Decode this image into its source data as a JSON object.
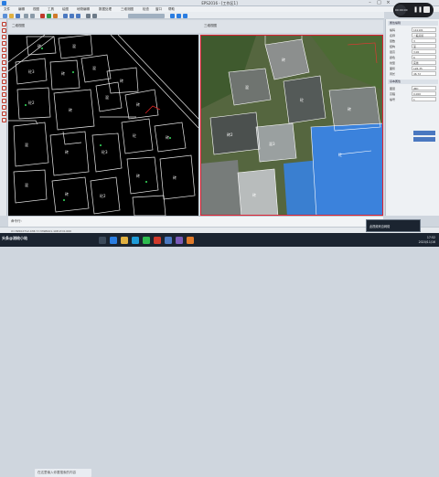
{
  "window": {
    "title": "EPS2016 - [工作区1]",
    "min": "–",
    "max": "□",
    "close": "×"
  },
  "menu": [
    "文件",
    "编辑",
    "视图",
    "工具",
    "绘图",
    "地物编辑",
    "数据处理",
    "三维测图",
    "检查",
    "窗口",
    "帮助"
  ],
  "viewtabs": [
    "二维视图",
    "三维视图"
  ],
  "cad": {
    "labels": [
      "砖",
      "混",
      "砼3",
      "砖",
      "混",
      "砖",
      "砼2",
      "砖",
      "混",
      "砖",
      "砼",
      "砖",
      "混",
      "砖",
      "砼3",
      "砖",
      "混",
      "砖",
      "砼2",
      "砖"
    ]
  },
  "photo": {
    "labels": [
      "砖",
      "混",
      "砼",
      "砖",
      "砖2",
      "混3",
      "砖",
      "砼"
    ]
  },
  "right_panel": {
    "title": "属性编辑",
    "rows": [
      {
        "k": "编码",
        "v": "141101"
      },
      {
        "k": "名称",
        "v": "一般房屋"
      },
      {
        "k": "层数",
        "v": "3"
      },
      {
        "k": "结构",
        "v": "混"
      },
      {
        "k": "层高",
        "v": "3.00"
      },
      {
        "k": "颜色",
        "v": "6"
      },
      {
        "k": "线型",
        "v": "实线"
      },
      {
        "k": "面积",
        "v": "126.35"
      },
      {
        "k": "周长",
        "v": "46.72"
      }
    ],
    "section2": "基本属性",
    "rows2": [
      {
        "k": "图层",
        "v": "JMD"
      },
      {
        "k": "高程",
        "v": "0.000"
      },
      {
        "k": "编号",
        "v": "1"
      }
    ]
  },
  "command": {
    "prompt": "命令行:"
  },
  "status": "X=39502712.436  Y=3398421.108  Z=0.000",
  "taskbar": {
    "search_placeholder": "在这里输入你要搜索的内容",
    "time": "17:52",
    "date": "2020/11/16",
    "watermark": "头条@测绘小站"
  },
  "recorder": {
    "elapsed": "00:00:00"
  },
  "overlay": "此视频来自网络"
}
